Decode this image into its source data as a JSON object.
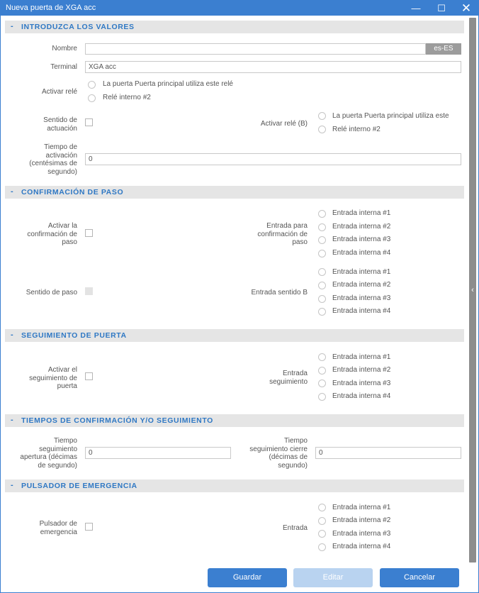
{
  "window": {
    "title": "Nueva puerta de XGA acc",
    "minimize": "—",
    "maximize": "☐",
    "close": "✕"
  },
  "sections": {
    "values": {
      "toggle": "-",
      "title": "INTRODUZCA LOS VALORES"
    },
    "confirm": {
      "toggle": "-",
      "title": "CONFIRMACIÓN DE PASO"
    },
    "tracking": {
      "toggle": "-",
      "title": "SEGUIMIENTO DE PUERTA"
    },
    "times": {
      "toggle": "-",
      "title": "TIEMPOS DE CONFIRMACIÓN Y/O SEGUIMIENTO"
    },
    "emergency": {
      "toggle": "-",
      "title": "PULSADOR DE EMERGENCIA"
    }
  },
  "values": {
    "nombre_label": "Nombre",
    "nombre_value": "",
    "lang_badge": "es-ES",
    "terminal_label": "Terminal",
    "terminal_value": "XGA acc",
    "activar_rele_label": "Activar relé",
    "activar_rele_options": [
      "La puerta Puerta principal utiliza este relé",
      "Relé interno #2"
    ],
    "sentido_label_1": "Sentido de",
    "sentido_label_2": "actuación",
    "activar_rele_b_label": "Activar relé (B)",
    "activar_rele_b_options": [
      "La puerta Puerta principal utiliza este",
      "Relé interno #2"
    ],
    "tiempo_label_1": "Tiempo de",
    "tiempo_label_2": "activación",
    "tiempo_label_3": "(centésimas de",
    "tiempo_label_4": "segundo)",
    "tiempo_value": "0"
  },
  "confirm": {
    "activar_label_1": "Activar la",
    "activar_label_2": "confirmación de",
    "activar_label_3": "paso",
    "entrada_label_1": "Entrada para",
    "entrada_label_2": "confirmación de",
    "entrada_label_3": "paso",
    "entrada_options": [
      "Entrada interna #1",
      "Entrada interna #2",
      "Entrada interna #3",
      "Entrada interna #4"
    ],
    "sentido_label": "Sentido de paso",
    "sentido_b_label": "Entrada sentido B",
    "sentido_b_options": [
      "Entrada interna #1",
      "Entrada interna #2",
      "Entrada interna #3",
      "Entrada interna #4"
    ]
  },
  "tracking": {
    "activar_label_1": "Activar el",
    "activar_label_2": "seguimiento de",
    "activar_label_3": "puerta",
    "entrada_label_1": "Entrada",
    "entrada_label_2": "seguimiento",
    "entrada_options": [
      "Entrada interna #1",
      "Entrada interna #2",
      "Entrada interna #3",
      "Entrada interna #4"
    ]
  },
  "times": {
    "apertura_label_1": "Tiempo",
    "apertura_label_2": "seguimiento",
    "apertura_label_3": "apertura (décimas",
    "apertura_label_4": "de segundo)",
    "apertura_value": "0",
    "cierre_label_1": "Tiempo",
    "cierre_label_2": "seguimiento cierre",
    "cierre_label_3": "(décimas de",
    "cierre_label_4": "segundo)",
    "cierre_value": "0"
  },
  "emergency": {
    "pulsador_label_1": "Pulsador de",
    "pulsador_label_2": "emergencia",
    "entrada_label": "Entrada",
    "entrada_options": [
      "Entrada interna #1",
      "Entrada interna #2",
      "Entrada interna #3",
      "Entrada interna #4"
    ]
  },
  "footer": {
    "guardar": "Guardar",
    "editar": "Editar",
    "cancelar": "Cancelar"
  },
  "colors": {
    "accent": "#3b7fd0",
    "section_bg": "#e5e5e5",
    "section_text": "#2f78c4",
    "disabled_button": "#b9d3f0"
  }
}
